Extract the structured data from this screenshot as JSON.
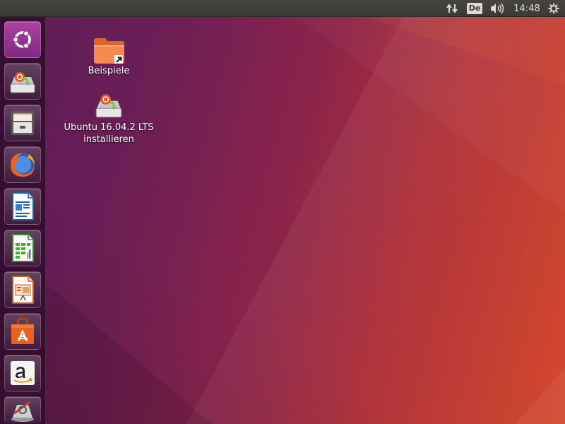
{
  "top_panel": {
    "keyboard_layout": "De",
    "clock": "14:48",
    "icons": [
      "network-icon",
      "keyboard-layout-indicator",
      "sound-icon",
      "session-gear-icon"
    ]
  },
  "launcher": {
    "items": [
      {
        "name": "dash-home",
        "icon": "ubuntu-logo-icon"
      },
      {
        "name": "install-ubuntu",
        "icon": "installer-icon"
      },
      {
        "name": "files",
        "icon": "file-cabinet-icon"
      },
      {
        "name": "firefox",
        "icon": "firefox-icon"
      },
      {
        "name": "libreoffice-writer",
        "icon": "writer-icon"
      },
      {
        "name": "libreoffice-calc",
        "icon": "calc-icon"
      },
      {
        "name": "libreoffice-impress",
        "icon": "impress-icon"
      },
      {
        "name": "ubuntu-software",
        "icon": "software-bag-icon"
      },
      {
        "name": "amazon",
        "icon": "amazon-icon"
      },
      {
        "name": "system-settings",
        "icon": "settings-icon"
      }
    ]
  },
  "desktop": {
    "icons": [
      {
        "label": "Beispiele",
        "icon": "folder-link-icon"
      },
      {
        "label_line1": "Ubuntu 16.04.2 LTS",
        "label_line2": "installieren",
        "icon": "installer-icon"
      }
    ]
  },
  "colors": {
    "panel": "#3c3b37",
    "wallpaper_left": "#5a1c57",
    "wallpaper_right": "#d4482d",
    "ubuntu_orange": "#e95420"
  }
}
